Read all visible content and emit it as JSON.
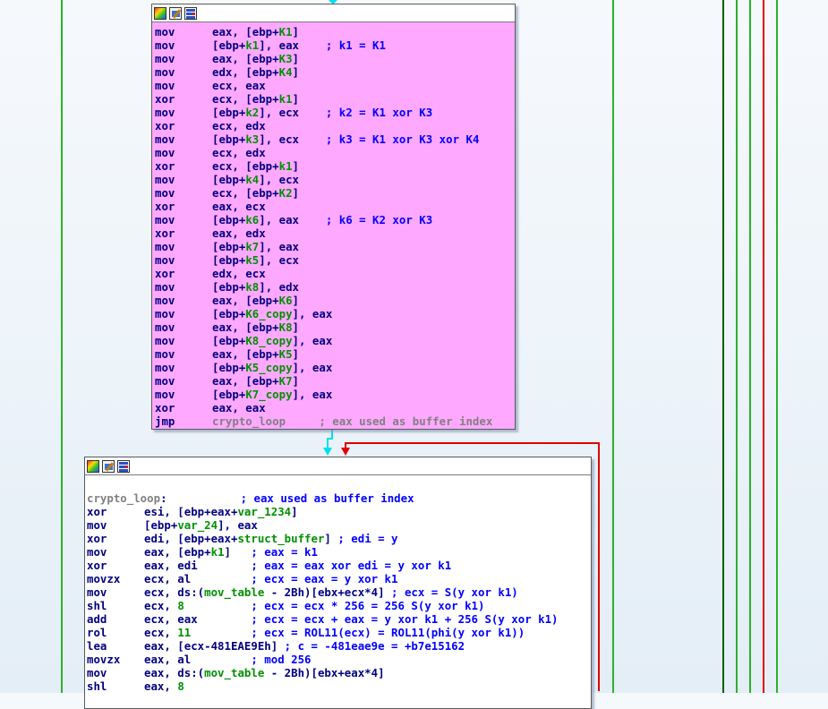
{
  "colors": {
    "background": "#eef4fa",
    "node1_bg": "#ffa8ff",
    "node2_bg": "#ffffff",
    "edge_cyan": "#00e0f0",
    "edge_red": "#e00000",
    "edge_green": "#2ab22a",
    "edge_darkgreen": "#006000",
    "mnemonic": "#000080",
    "variable": "#009000",
    "comment": "#0000ff",
    "label": "#808080"
  },
  "node_icons": [
    "color-graph-icon",
    "edit-node-icon",
    "xrefs-icon"
  ],
  "block1": {
    "lines": [
      {
        "mn": "mov",
        "segs": [
          [
            "o",
            "eax, [ebp+"
          ],
          [
            "v",
            "K1"
          ],
          [
            "o",
            "]"
          ]
        ]
      },
      {
        "mn": "mov",
        "segs": [
          [
            "o",
            "[ebp+"
          ],
          [
            "v",
            "k1"
          ],
          [
            "o",
            "], eax"
          ],
          [
            "c",
            "    ; k1 = K1"
          ]
        ]
      },
      {
        "mn": "mov",
        "segs": [
          [
            "o",
            "eax, [ebp+"
          ],
          [
            "v",
            "K3"
          ],
          [
            "o",
            "]"
          ]
        ]
      },
      {
        "mn": "mov",
        "segs": [
          [
            "o",
            "edx, [ebp+"
          ],
          [
            "v",
            "K4"
          ],
          [
            "o",
            "]"
          ]
        ]
      },
      {
        "mn": "mov",
        "segs": [
          [
            "o",
            "ecx, eax"
          ]
        ]
      },
      {
        "mn": "xor",
        "segs": [
          [
            "o",
            "ecx, [ebp+"
          ],
          [
            "v",
            "k1"
          ],
          [
            "o",
            "]"
          ]
        ]
      },
      {
        "mn": "mov",
        "segs": [
          [
            "o",
            "[ebp+"
          ],
          [
            "v",
            "k2"
          ],
          [
            "o",
            "], ecx"
          ],
          [
            "c",
            "    ; k2 = K1 xor K3"
          ]
        ]
      },
      {
        "mn": "xor",
        "segs": [
          [
            "o",
            "ecx, edx"
          ]
        ]
      },
      {
        "mn": "mov",
        "segs": [
          [
            "o",
            "[ebp+"
          ],
          [
            "v",
            "k3"
          ],
          [
            "o",
            "], ecx"
          ],
          [
            "c",
            "    ; k3 = K1 xor K3 xor K4"
          ]
        ]
      },
      {
        "mn": "mov",
        "segs": [
          [
            "o",
            "ecx, edx"
          ]
        ]
      },
      {
        "mn": "xor",
        "segs": [
          [
            "o",
            "ecx, [ebp+"
          ],
          [
            "v",
            "k1"
          ],
          [
            "o",
            "]"
          ]
        ]
      },
      {
        "mn": "mov",
        "segs": [
          [
            "o",
            "[ebp+"
          ],
          [
            "v",
            "k4"
          ],
          [
            "o",
            "], ecx"
          ]
        ]
      },
      {
        "mn": "mov",
        "segs": [
          [
            "o",
            "ecx, [ebp+"
          ],
          [
            "v",
            "K2"
          ],
          [
            "o",
            "]"
          ]
        ]
      },
      {
        "mn": "xor",
        "segs": [
          [
            "o",
            "eax, ecx"
          ]
        ]
      },
      {
        "mn": "mov",
        "segs": [
          [
            "o",
            "[ebp+"
          ],
          [
            "v",
            "k6"
          ],
          [
            "o",
            "], eax"
          ],
          [
            "c",
            "    ; k6 = K2 xor K3"
          ]
        ]
      },
      {
        "mn": "xor",
        "segs": [
          [
            "o",
            "eax, edx"
          ]
        ]
      },
      {
        "mn": "mov",
        "segs": [
          [
            "o",
            "[ebp+"
          ],
          [
            "v",
            "k7"
          ],
          [
            "o",
            "], eax"
          ]
        ]
      },
      {
        "mn": "mov",
        "segs": [
          [
            "o",
            "[ebp+"
          ],
          [
            "v",
            "k5"
          ],
          [
            "o",
            "], ecx"
          ]
        ]
      },
      {
        "mn": "xor",
        "segs": [
          [
            "o",
            "edx, ecx"
          ]
        ]
      },
      {
        "mn": "mov",
        "segs": [
          [
            "o",
            "[ebp+"
          ],
          [
            "v",
            "k8"
          ],
          [
            "o",
            "], edx"
          ]
        ]
      },
      {
        "mn": "mov",
        "segs": [
          [
            "o",
            "eax, [ebp+"
          ],
          [
            "v",
            "K6"
          ],
          [
            "o",
            "]"
          ]
        ]
      },
      {
        "mn": "mov",
        "segs": [
          [
            "o",
            "[ebp+"
          ],
          [
            "v",
            "K6_copy"
          ],
          [
            "o",
            "], eax"
          ]
        ]
      },
      {
        "mn": "mov",
        "segs": [
          [
            "o",
            "eax, [ebp+"
          ],
          [
            "v",
            "K8"
          ],
          [
            "o",
            "]"
          ]
        ]
      },
      {
        "mn": "mov",
        "segs": [
          [
            "o",
            "[ebp+"
          ],
          [
            "v",
            "K8_copy"
          ],
          [
            "o",
            "], eax"
          ]
        ]
      },
      {
        "mn": "mov",
        "segs": [
          [
            "o",
            "eax, [ebp+"
          ],
          [
            "v",
            "K5"
          ],
          [
            "o",
            "]"
          ]
        ]
      },
      {
        "mn": "mov",
        "segs": [
          [
            "o",
            "[ebp+"
          ],
          [
            "v",
            "K5_copy"
          ],
          [
            "o",
            "], eax"
          ]
        ]
      },
      {
        "mn": "mov",
        "segs": [
          [
            "o",
            "eax, [ebp+"
          ],
          [
            "v",
            "K7"
          ],
          [
            "o",
            "]"
          ]
        ]
      },
      {
        "mn": "mov",
        "segs": [
          [
            "o",
            "[ebp+"
          ],
          [
            "v",
            "K7_copy"
          ],
          [
            "o",
            "], eax"
          ]
        ]
      },
      {
        "mn": "xor",
        "segs": [
          [
            "o",
            "eax, eax"
          ]
        ]
      },
      {
        "mn": "jmp",
        "segs": [
          [
            "l",
            "crypto_loop"
          ],
          [
            "g",
            "     ; eax used as buffer index"
          ]
        ]
      }
    ]
  },
  "block2": {
    "label_line": [
      [
        "l",
        "crypto_loop"
      ],
      [
        "o",
        ":"
      ],
      [
        "c",
        "           ; eax used as buffer index"
      ]
    ],
    "lines": [
      {
        "mn": "xor",
        "segs": [
          [
            "o",
            "esi, [ebp+eax+"
          ],
          [
            "v",
            "var_1234"
          ],
          [
            "o",
            "]"
          ]
        ]
      },
      {
        "mn": "mov",
        "segs": [
          [
            "o",
            "[ebp+"
          ],
          [
            "v",
            "var_24"
          ],
          [
            "o",
            "], eax"
          ]
        ]
      },
      {
        "mn": "xor",
        "segs": [
          [
            "o",
            "edi, [ebp+eax+"
          ],
          [
            "v",
            "struct_buffer"
          ],
          [
            "o",
            "]"
          ],
          [
            "c",
            " ; edi = y"
          ]
        ]
      },
      {
        "mn": "mov",
        "segs": [
          [
            "o",
            "eax, [ebp+"
          ],
          [
            "v",
            "k1"
          ],
          [
            "o",
            "]"
          ],
          [
            "c",
            "   ; eax = k1"
          ]
        ]
      },
      {
        "mn": "xor",
        "segs": [
          [
            "o",
            "eax, edi"
          ],
          [
            "c",
            "        ; eax = eax xor edi = y xor k1"
          ]
        ]
      },
      {
        "mn": "movzx",
        "segs": [
          [
            "o",
            "ecx, al"
          ],
          [
            "c",
            "         ; ecx = eax = y xor k1"
          ]
        ]
      },
      {
        "mn": "mov",
        "segs": [
          [
            "o",
            "ecx, ds:("
          ],
          [
            "v",
            "mov_table"
          ],
          [
            "o",
            " - 2Bh)[ebx+ecx*4]"
          ],
          [
            "c",
            " ; ecx = S(y xor k1)"
          ]
        ]
      },
      {
        "mn": "shl",
        "segs": [
          [
            "o",
            "ecx, "
          ],
          [
            "n",
            "8"
          ],
          [
            "c",
            "          ; ecx = ecx * 256 = 256 S(y xor k1)"
          ]
        ]
      },
      {
        "mn": "add",
        "segs": [
          [
            "o",
            "ecx, eax"
          ],
          [
            "c",
            "        ; ecx = ecx + eax = y xor k1 + 256 S(y xor k1)"
          ]
        ]
      },
      {
        "mn": "rol",
        "segs": [
          [
            "o",
            "ecx, "
          ],
          [
            "n",
            "11"
          ],
          [
            "c",
            "         ; ecx = ROL11(ecx) = ROL11(phi(y xor k1))"
          ]
        ]
      },
      {
        "mn": "lea",
        "segs": [
          [
            "o",
            "eax, [ecx-481EAE9Eh]"
          ],
          [
            "c",
            " ; c = -481eae9e = +b7e15162"
          ]
        ]
      },
      {
        "mn": "movzx",
        "segs": [
          [
            "o",
            "eax, al"
          ],
          [
            "c",
            "         ; mod 256"
          ]
        ]
      },
      {
        "mn": "mov",
        "segs": [
          [
            "o",
            "eax, ds:("
          ],
          [
            "v",
            "mov_table"
          ],
          [
            "o",
            " - 2Bh)[ebx+eax*4]"
          ]
        ]
      },
      {
        "mn": "shl",
        "segs": [
          [
            "o",
            "eax, "
          ],
          [
            "n",
            "8"
          ]
        ]
      }
    ]
  }
}
